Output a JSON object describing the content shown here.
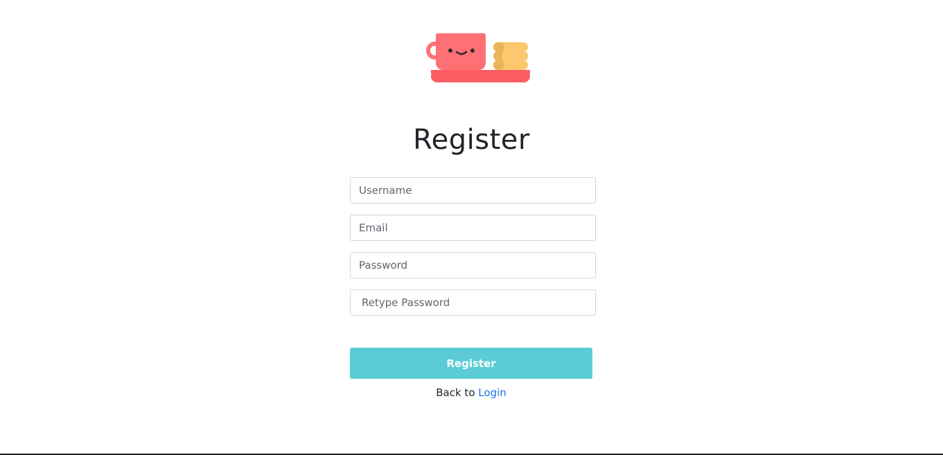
{
  "page": {
    "title": "Register",
    "logo_icon": "teacup-and-cookies-icon",
    "colors": {
      "accent_button": "#5bccd6",
      "link": "#1a73e8",
      "cup": "#fe7074",
      "tray": "#fd5c63",
      "cookies": "#fcc86d"
    }
  },
  "form": {
    "username_placeholder": "Username",
    "email_placeholder": "Email",
    "password_placeholder": "Password",
    "retype_placeholder": "Retype Password",
    "submit_label": "Register"
  },
  "footer": {
    "back_text": "Back to",
    "login_link": "Login"
  }
}
